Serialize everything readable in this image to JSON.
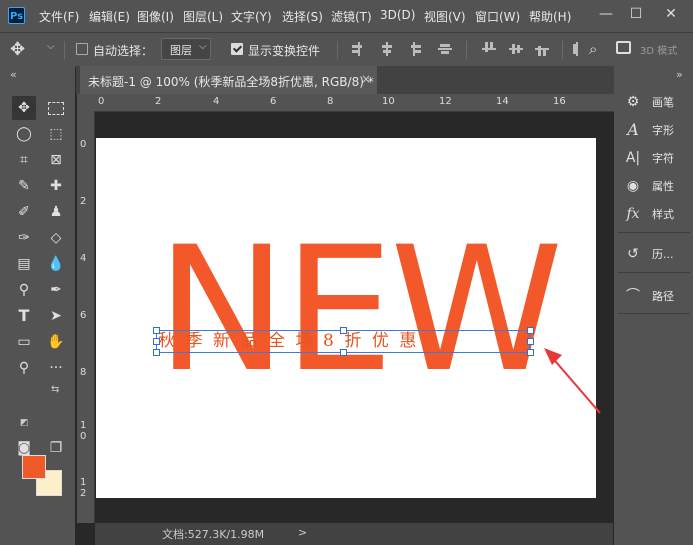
{
  "app": {
    "logo": "Ps"
  },
  "menu": [
    "文件(F)",
    "编辑(E)",
    "图像(I)",
    "图层(L)",
    "文字(Y)",
    "选择(S)",
    "滤镜(T)",
    "3D(D)",
    "视图(V)",
    "窗口(W)",
    "帮助(H)"
  ],
  "window_controls": {
    "minimize": "—",
    "maximize": "☐",
    "close": "✕"
  },
  "options": {
    "auto_select_label": "自动选择：",
    "auto_select_checked": false,
    "layer_select_value": "图层",
    "show_transform_label": "显示变换控件",
    "show_transform_checked": true,
    "mode_3d_label": "3D 模式"
  },
  "panel_collapse_left": "«",
  "panel_collapse_right": "»",
  "document": {
    "tab_title": "未标题-1 @ 100% (秋季新品全场8折优惠, RGB/8) *",
    "tab_close": "×",
    "ruler_h": [
      "0",
      "2",
      "4",
      "6",
      "8",
      "10",
      "12",
      "14",
      "16"
    ],
    "ruler_v": [
      "0",
      "2",
      "4",
      "6",
      "8",
      "1\n0",
      "1\n2"
    ],
    "canvas_big_text": "NEW",
    "canvas_text": "秋季新品全场8折优惠",
    "status": "文档:527.3K/1.98M",
    "status_arrow": ">"
  },
  "colors": {
    "foreground": "#f05a28",
    "background": "#fdf0c8",
    "accent_text": "#f2582a"
  },
  "panels": [
    {
      "icon": "brush-settings-icon",
      "glyph": "⚙",
      "label": "画笔"
    },
    {
      "icon": "glyph-A-icon",
      "glyph": "A",
      "label": "字形"
    },
    {
      "icon": "character-icon",
      "glyph": "A|",
      "label": "字符"
    },
    {
      "icon": "properties-icon",
      "glyph": "◉",
      "label": "属性"
    },
    {
      "icon": "styles-icon",
      "glyph": "fx",
      "label": "样式"
    },
    {
      "icon": "history-icon",
      "glyph": "↺",
      "label": "历..."
    },
    {
      "icon": "paths-icon",
      "glyph": "⌒",
      "label": "路径"
    }
  ]
}
